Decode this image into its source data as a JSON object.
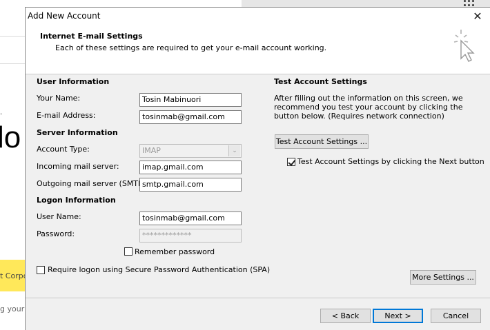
{
  "background": {
    "big_text": "lo",
    "dot": ".",
    "yellow_text": "t Corpo",
    "gray_text": "g your p"
  },
  "dialog": {
    "title": "Add New Account",
    "close_glyph": "✕",
    "header_title": "Internet E-mail Settings",
    "header_sub": "Each of these settings are required to get your e-mail account working."
  },
  "user_info": {
    "heading": "User Information",
    "name_label": "Your Name:",
    "name_value": "Tosin Mabinuori",
    "email_label": "E-mail Address:",
    "email_value": "tosinmab@gmail.com"
  },
  "server_info": {
    "heading": "Server Information",
    "account_type_label": "Account Type:",
    "account_type_value": "IMAP",
    "incoming_label": "Incoming mail server:",
    "incoming_value": "imap.gmail.com",
    "outgoing_label": "Outgoing mail server (SMTP):",
    "outgoing_value": "smtp.gmail.com"
  },
  "logon_info": {
    "heading": "Logon Information",
    "username_label": "User Name:",
    "username_value": "tosinmab@gmail.com",
    "password_label": "Password:",
    "password_value": "*************",
    "remember_label": "Remember password",
    "remember_checked": false,
    "spa_label": "Require logon using Secure Password Authentication (SPA)",
    "spa_checked": false
  },
  "test_settings": {
    "heading": "Test Account Settings",
    "description": "After filling out the information on this screen, we recommend you test your account by clicking the button below. (Requires network connection)",
    "test_button": "Test Account Settings ...",
    "auto_test_label": "Test Account Settings by clicking the Next button",
    "auto_test_checked": true,
    "more_settings_button": "More Settings ..."
  },
  "footer": {
    "back_button": "< Back",
    "next_button": "Next >",
    "cancel_button": "Cancel"
  },
  "colors": {
    "accent": "#0078d7",
    "yellow_banner": "#ffe85a"
  }
}
